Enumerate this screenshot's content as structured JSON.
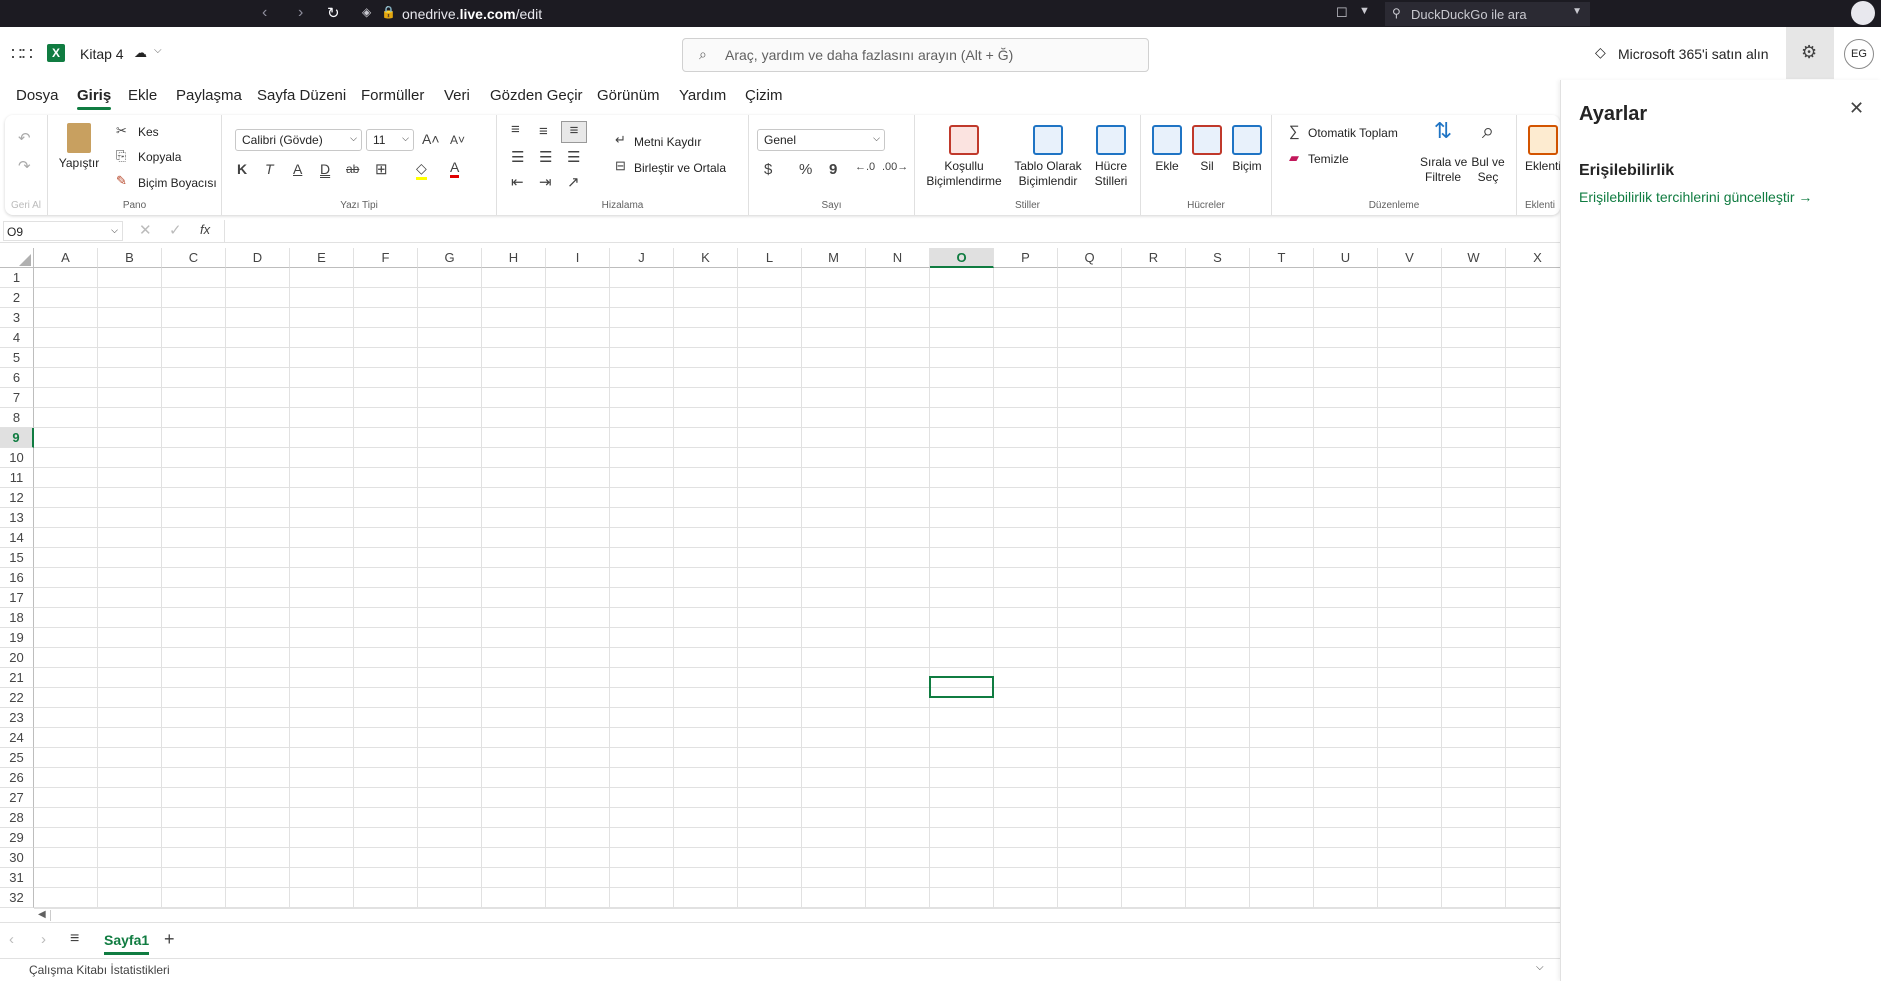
{
  "browser": {
    "url_prefix": "onedrive.",
    "url_domain": "live.com",
    "url_path": "/edit",
    "search_placeholder": "DuckDuckGo ile ara"
  },
  "app": {
    "file_name": "Kitap 4",
    "search_placeholder": "Araç, yardım ve daha fazlasını arayın (Alt + Ğ)",
    "buy_label": "Microsoft 365'i satın alın",
    "user_initials": "EG"
  },
  "tabs": [
    "Dosya",
    "Giriş",
    "Ekle",
    "Paylaşma",
    "Sayfa Düzeni",
    "Formüller",
    "Veri",
    "Gözden Geçir",
    "Görünüm",
    "Yardım",
    "Çizim"
  ],
  "ribbon": {
    "undo_group": "Geri Al",
    "clipboard": {
      "paste": "Yapıştır",
      "cut": "Kes",
      "copy": "Kopyala",
      "format_painter": "Biçim Boyacısı",
      "group": "Pano"
    },
    "font": {
      "name": "Calibri (Gövde)",
      "size": "11",
      "bold": "K",
      "italic": "T",
      "underline": "A",
      "double_underline": "D",
      "strike": "ab",
      "group": "Yazı Tipi"
    },
    "alignment": {
      "wrap": "Metni Kaydır",
      "merge": "Birleştir ve Ortala",
      "group": "Hizalama"
    },
    "number": {
      "format": "Genel",
      "currency": "$",
      "percent": "%",
      "comma": "9",
      "group": "Sayı"
    },
    "styles": {
      "conditional_1": "Koşullu",
      "conditional_2": "Biçimlendirme",
      "table_1": "Tablo Olarak",
      "table_2": "Biçimlendir",
      "cell_1": "Hücre",
      "cell_2": "Stilleri",
      "group": "Stiller"
    },
    "cells": {
      "insert": "Ekle",
      "delete": "Sil",
      "format": "Biçim",
      "group": "Hücreler"
    },
    "editing": {
      "autosum": "Otomatik Toplam",
      "clear": "Temizle",
      "sort_1": "Sırala ve",
      "sort_2": "Filtrele",
      "find_1": "Bul ve",
      "find_2": "Seç",
      "group": "Düzenleme"
    },
    "addins": {
      "label": "Eklenti",
      "group": "Eklenti"
    }
  },
  "formula_bar": {
    "name_box": "O9",
    "fx": "fx"
  },
  "columns": [
    "A",
    "B",
    "C",
    "D",
    "E",
    "F",
    "G",
    "H",
    "I",
    "J",
    "K",
    "L",
    "M",
    "N",
    "O",
    "P",
    "Q",
    "R",
    "S",
    "T",
    "U",
    "V",
    "W",
    "X"
  ],
  "rows": [
    "1",
    "2",
    "3",
    "4",
    "5",
    "6",
    "7",
    "8",
    "9",
    "10",
    "11",
    "12",
    "13",
    "14",
    "15",
    "16",
    "17",
    "18",
    "19",
    "20",
    "21",
    "22",
    "23",
    "24",
    "25",
    "26",
    "27",
    "28",
    "29",
    "30",
    "31",
    "32"
  ],
  "selected": {
    "column": "O",
    "row": "9"
  },
  "sheet": {
    "name": "Sayfa1",
    "add": "+"
  },
  "status": {
    "label": "Çalışma Kitabı İstatistikleri"
  },
  "panel": {
    "title": "Ayarlar",
    "section": "Erişilebilirlik",
    "link": "Erişilebilirlik tercihlerini güncelleştir",
    "link_arrow": "→"
  },
  "colors": {
    "excel_green": "#107c41",
    "selection": "#107c41"
  }
}
